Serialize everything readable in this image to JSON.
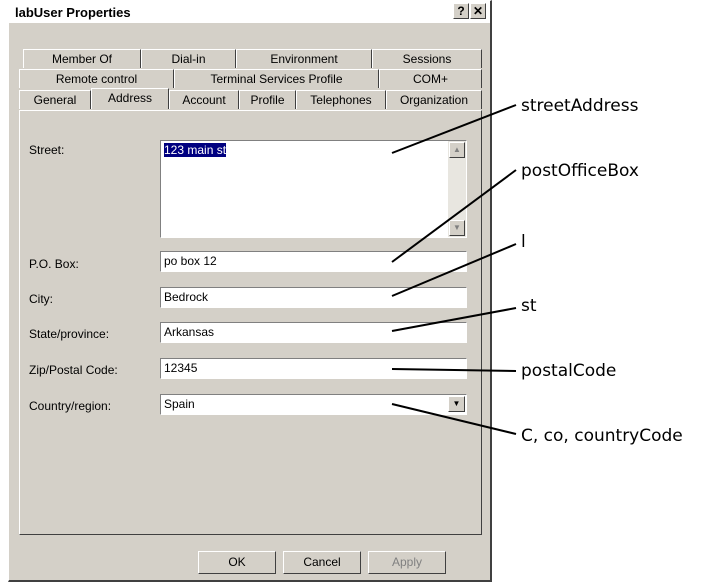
{
  "window": {
    "title": "labUser Properties",
    "help_button": "?",
    "close_button": "✕"
  },
  "tabs": {
    "row1": [
      "Member Of",
      "Dial-in",
      "Environment",
      "Sessions"
    ],
    "row2": [
      "Remote control",
      "Terminal Services Profile",
      "COM+"
    ],
    "row3": [
      "General",
      "Address",
      "Account",
      "Profile",
      "Telephones",
      "Organization"
    ],
    "active": "Address"
  },
  "form": {
    "street_label": "Street:",
    "street_value": "123 main st",
    "pobox_label": "P.O. Box:",
    "pobox_value": "po box 12",
    "city_label": "City:",
    "city_value": "Bedrock",
    "state_label": "State/province:",
    "state_value": "Arkansas",
    "zip_label": "Zip/Postal Code:",
    "zip_value": "12345",
    "country_label": "Country/region:",
    "country_value": "Spain"
  },
  "buttons": {
    "ok": "OK",
    "cancel": "Cancel",
    "apply": "Apply"
  },
  "annotations": {
    "street": "streetAddress",
    "pobox": "postOfficeBox",
    "city": "l",
    "state": "st",
    "zip": "postalCode",
    "country": "C, co, countryCode"
  }
}
